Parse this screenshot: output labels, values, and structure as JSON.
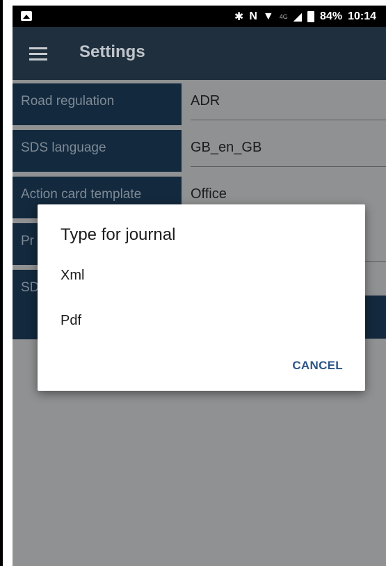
{
  "status": {
    "battery": "84%",
    "time": "10:14",
    "network": "4G"
  },
  "appbar": {
    "title": "Settings"
  },
  "settings": [
    {
      "label": "Road regulation",
      "value": "ADR"
    },
    {
      "label": "SDS language",
      "value": "GB_en_GB"
    },
    {
      "label": "Action card template",
      "value": "Office"
    },
    {
      "label": "Pr",
      "value": ""
    },
    {
      "label": "SD",
      "value": ""
    }
  ],
  "dialog": {
    "title": "Type for journal",
    "options": [
      "Xml",
      "Pdf"
    ],
    "cancel": "CANCEL"
  }
}
